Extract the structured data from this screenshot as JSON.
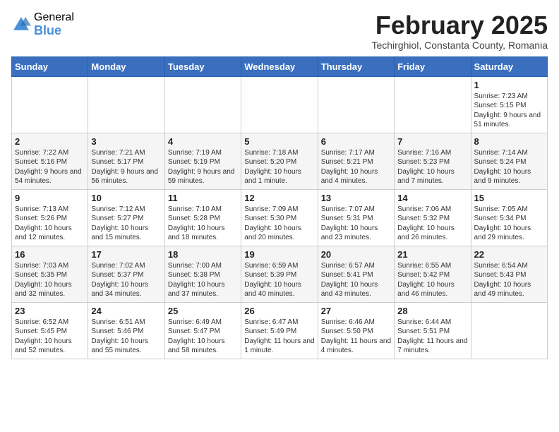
{
  "header": {
    "logo_general": "General",
    "logo_blue": "Blue",
    "month_year": "February 2025",
    "location": "Techirghiol, Constanta County, Romania"
  },
  "weekdays": [
    "Sunday",
    "Monday",
    "Tuesday",
    "Wednesday",
    "Thursday",
    "Friday",
    "Saturday"
  ],
  "weeks": [
    [
      {
        "day": "",
        "info": ""
      },
      {
        "day": "",
        "info": ""
      },
      {
        "day": "",
        "info": ""
      },
      {
        "day": "",
        "info": ""
      },
      {
        "day": "",
        "info": ""
      },
      {
        "day": "",
        "info": ""
      },
      {
        "day": "1",
        "info": "Sunrise: 7:23 AM\nSunset: 5:15 PM\nDaylight: 9 hours and 51 minutes."
      }
    ],
    [
      {
        "day": "2",
        "info": "Sunrise: 7:22 AM\nSunset: 5:16 PM\nDaylight: 9 hours and 54 minutes."
      },
      {
        "day": "3",
        "info": "Sunrise: 7:21 AM\nSunset: 5:17 PM\nDaylight: 9 hours and 56 minutes."
      },
      {
        "day": "4",
        "info": "Sunrise: 7:19 AM\nSunset: 5:19 PM\nDaylight: 9 hours and 59 minutes."
      },
      {
        "day": "5",
        "info": "Sunrise: 7:18 AM\nSunset: 5:20 PM\nDaylight: 10 hours and 1 minute."
      },
      {
        "day": "6",
        "info": "Sunrise: 7:17 AM\nSunset: 5:21 PM\nDaylight: 10 hours and 4 minutes."
      },
      {
        "day": "7",
        "info": "Sunrise: 7:16 AM\nSunset: 5:23 PM\nDaylight: 10 hours and 7 minutes."
      },
      {
        "day": "8",
        "info": "Sunrise: 7:14 AM\nSunset: 5:24 PM\nDaylight: 10 hours and 9 minutes."
      }
    ],
    [
      {
        "day": "9",
        "info": "Sunrise: 7:13 AM\nSunset: 5:26 PM\nDaylight: 10 hours and 12 minutes."
      },
      {
        "day": "10",
        "info": "Sunrise: 7:12 AM\nSunset: 5:27 PM\nDaylight: 10 hours and 15 minutes."
      },
      {
        "day": "11",
        "info": "Sunrise: 7:10 AM\nSunset: 5:28 PM\nDaylight: 10 hours and 18 minutes."
      },
      {
        "day": "12",
        "info": "Sunrise: 7:09 AM\nSunset: 5:30 PM\nDaylight: 10 hours and 20 minutes."
      },
      {
        "day": "13",
        "info": "Sunrise: 7:07 AM\nSunset: 5:31 PM\nDaylight: 10 hours and 23 minutes."
      },
      {
        "day": "14",
        "info": "Sunrise: 7:06 AM\nSunset: 5:32 PM\nDaylight: 10 hours and 26 minutes."
      },
      {
        "day": "15",
        "info": "Sunrise: 7:05 AM\nSunset: 5:34 PM\nDaylight: 10 hours and 29 minutes."
      }
    ],
    [
      {
        "day": "16",
        "info": "Sunrise: 7:03 AM\nSunset: 5:35 PM\nDaylight: 10 hours and 32 minutes."
      },
      {
        "day": "17",
        "info": "Sunrise: 7:02 AM\nSunset: 5:37 PM\nDaylight: 10 hours and 34 minutes."
      },
      {
        "day": "18",
        "info": "Sunrise: 7:00 AM\nSunset: 5:38 PM\nDaylight: 10 hours and 37 minutes."
      },
      {
        "day": "19",
        "info": "Sunrise: 6:59 AM\nSunset: 5:39 PM\nDaylight: 10 hours and 40 minutes."
      },
      {
        "day": "20",
        "info": "Sunrise: 6:57 AM\nSunset: 5:41 PM\nDaylight: 10 hours and 43 minutes."
      },
      {
        "day": "21",
        "info": "Sunrise: 6:55 AM\nSunset: 5:42 PM\nDaylight: 10 hours and 46 minutes."
      },
      {
        "day": "22",
        "info": "Sunrise: 6:54 AM\nSunset: 5:43 PM\nDaylight: 10 hours and 49 minutes."
      }
    ],
    [
      {
        "day": "23",
        "info": "Sunrise: 6:52 AM\nSunset: 5:45 PM\nDaylight: 10 hours and 52 minutes."
      },
      {
        "day": "24",
        "info": "Sunrise: 6:51 AM\nSunset: 5:46 PM\nDaylight: 10 hours and 55 minutes."
      },
      {
        "day": "25",
        "info": "Sunrise: 6:49 AM\nSunset: 5:47 PM\nDaylight: 10 hours and 58 minutes."
      },
      {
        "day": "26",
        "info": "Sunrise: 6:47 AM\nSunset: 5:49 PM\nDaylight: 11 hours and 1 minute."
      },
      {
        "day": "27",
        "info": "Sunrise: 6:46 AM\nSunset: 5:50 PM\nDaylight: 11 hours and 4 minutes."
      },
      {
        "day": "28",
        "info": "Sunrise: 6:44 AM\nSunset: 5:51 PM\nDaylight: 11 hours and 7 minutes."
      },
      {
        "day": "",
        "info": ""
      }
    ]
  ]
}
